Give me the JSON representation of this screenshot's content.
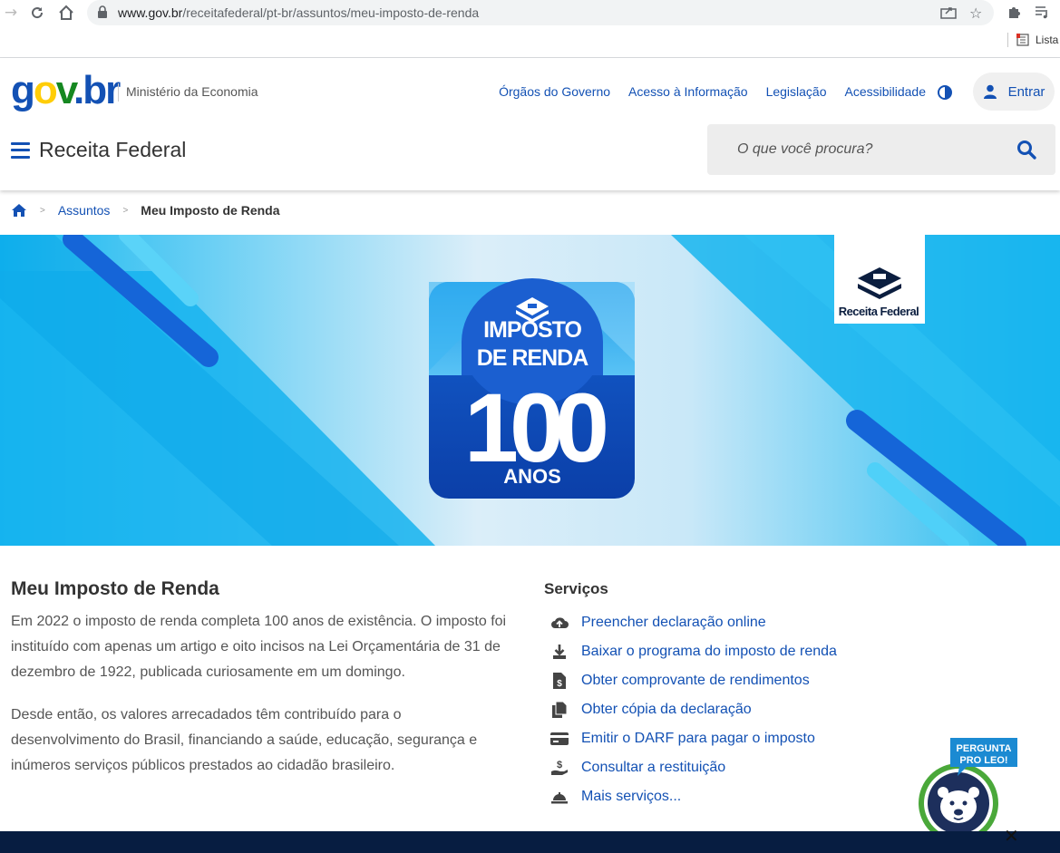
{
  "browser": {
    "url_host": "www.gov.br",
    "url_path": "/receitafederal/pt-br/assuntos/meu-imposto-de-renda",
    "reading_list_label": "Lista"
  },
  "header": {
    "logo_text": "gov.br",
    "ministry": "Ministério da Economia",
    "top_links": [
      "Órgãos do Governo",
      "Acesso à Informação",
      "Legislação",
      "Acessibilidade"
    ],
    "login_label": "Entrar",
    "site_name": "Receita Federal",
    "search_placeholder": "O que você procura?",
    "brand_color": "#1351b4"
  },
  "breadcrumb": {
    "items": [
      "Assuntos"
    ],
    "current": "Meu Imposto de Renda"
  },
  "banner": {
    "badge_line1": "IMPOSTO",
    "badge_line2": "DE RENDA",
    "badge_number": "100",
    "badge_line3": "ANOS",
    "logo_label": "Receita Federal"
  },
  "main": {
    "title": "Meu Imposto de Renda",
    "paragraphs": [
      "Em 2022 o imposto de renda completa 100 anos de existência. O imposto foi instituído com apenas um artigo e oito incisos na Lei Orçamentária de 31 de dezembro de 1922, publicada curiosamente em um domingo.",
      "Desde então, os valores arrecadados têm contribuído para o desenvolvimento do Brasil, financiando a saúde, educação, segurança e inúmeros serviços públicos prestados ao cidadão brasileiro."
    ]
  },
  "services": {
    "title": "Serviços",
    "items": [
      {
        "label": "Preencher declaração online",
        "icon": "cloud-upload-icon"
      },
      {
        "label": "Baixar o programa do imposto de renda",
        "icon": "download-icon"
      },
      {
        "label": "Obter comprovante de rendimentos",
        "icon": "file-invoice-dollar-icon"
      },
      {
        "label": "Obter cópia da declaração",
        "icon": "copy-icon"
      },
      {
        "label": "Emitir o DARF para pagar o imposto",
        "icon": "credit-card-icon"
      },
      {
        "label": "Consultar a restituição",
        "icon": "hand-holding-dollar-icon"
      },
      {
        "label": "Mais serviços...",
        "icon": "concierge-bell-icon"
      }
    ]
  },
  "leo": {
    "line1": "PERGUNTA",
    "line2": "PRO LEO!",
    "close": "✕"
  }
}
